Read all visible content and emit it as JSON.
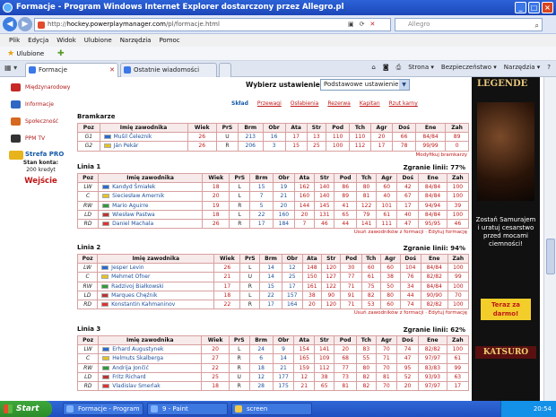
{
  "window": {
    "title": "Formacje - Program Windows Internet Explorer dostarczony przez Allegro.pl"
  },
  "address": {
    "prefix": "http://",
    "domain": "hockey.powerplaymanager.com",
    "path": "/pl/formacje.html",
    "search_placeholder": "Allegro"
  },
  "menu": [
    "Plik",
    "Edycja",
    "Widok",
    "Ulubione",
    "Narzędzia",
    "Pomoc"
  ],
  "favorites": {
    "label": "Ulubione"
  },
  "tabs": [
    {
      "label": "Formacje",
      "active": true
    },
    {
      "label": "Ostatnie wiadomości",
      "active": false
    }
  ],
  "commands": [
    "Strona ▾",
    "Bezpieczeństwo ▾",
    "Narzędzia ▾"
  ],
  "sidebar": {
    "items": [
      {
        "label": "Międzynarodowy",
        "color": "#c62828"
      },
      {
        "label": "Informacje",
        "color": "#2f67c4"
      },
      {
        "label": "Społeczność",
        "color": "#d6681f"
      },
      {
        "label": "PPM TV",
        "color": "#333333"
      }
    ],
    "strefa": "Strefa PRO",
    "stan_label": "Stan konta:",
    "stan_value": "200 kredyt",
    "logout": "Wejście"
  },
  "settings": {
    "label": "Wybierz ustawienie:",
    "value": "Podstawowe ustawienie"
  },
  "links": [
    "Skład",
    "Przewagi",
    "Osłabienia",
    "Rezerwa",
    "Kapitan",
    "Rzut karny"
  ],
  "columns": [
    "Poz",
    "Imię zawodnika",
    "Wiek",
    "PrS",
    "Brm",
    "Obr",
    "Ata",
    "Str",
    "Pod",
    "Tch",
    "Agr",
    "Doś",
    "Ene",
    "Zah"
  ],
  "goalies": {
    "title": "Bramkarze",
    "rows": [
      [
        "G1",
        "Mušil Čeleznik",
        "26",
        "U",
        "213",
        "16",
        "17",
        "13",
        "110",
        "110",
        "20",
        "66",
        "84/84",
        "89"
      ],
      [
        "G2",
        "Ján Pekár",
        "26",
        "R",
        "206",
        "3",
        "15",
        "25",
        "100",
        "112",
        "17",
        "78",
        "99/99",
        "0"
      ]
    ],
    "note": "Modyfikuj bramkarzy"
  },
  "lines": [
    {
      "title": "Linia 1",
      "zgranie": "Zgranie linii: 77%",
      "rows": [
        [
          "LW",
          "Kandyd Śmiałek",
          "18",
          "L",
          "15",
          "19",
          "162",
          "140",
          "86",
          "80",
          "60",
          "42",
          "84/84",
          "100"
        ],
        [
          "C",
          "Sieciesław Amernik",
          "20",
          "L",
          "7",
          "21",
          "160",
          "140",
          "89",
          "81",
          "40",
          "67",
          "84/84",
          "100"
        ],
        [
          "RW",
          "Mario Aguirre",
          "19",
          "R",
          "5",
          "20",
          "144",
          "145",
          "41",
          "122",
          "101",
          "17",
          "94/94",
          "39"
        ],
        [
          "LD",
          "Wiesław Pastwa",
          "18",
          "L",
          "22",
          "160",
          "20",
          "131",
          "65",
          "79",
          "61",
          "40",
          "84/84",
          "100"
        ],
        [
          "RD",
          "Daniel Machala",
          "26",
          "R",
          "17",
          "184",
          "7",
          "46",
          "44",
          "141",
          "111",
          "47",
          "95/95",
          "46"
        ]
      ],
      "note": "Usuń zawodników z formacji · Edytuj formację"
    },
    {
      "title": "Linia 2",
      "zgranie": "Zgranie linii: 94%",
      "rows": [
        [
          "LW",
          "Jesper Levin",
          "26",
          "L",
          "14",
          "12",
          "148",
          "120",
          "30",
          "60",
          "60",
          "104",
          "84/84",
          "100"
        ],
        [
          "C",
          "Mehmet Ofner",
          "21",
          "U",
          "14",
          "25",
          "150",
          "127",
          "77",
          "61",
          "38",
          "76",
          "82/82",
          "99"
        ],
        [
          "RW",
          "Radzivoj Białkowski",
          "17",
          "R",
          "15",
          "17",
          "161",
          "122",
          "71",
          "75",
          "50",
          "34",
          "84/84",
          "100"
        ],
        [
          "LD",
          "Marques Chęźnik",
          "18",
          "L",
          "22",
          "157",
          "38",
          "90",
          "91",
          "82",
          "80",
          "44",
          "90/90",
          "70"
        ],
        [
          "RD",
          "Konstantin Kahmaninov",
          "22",
          "R",
          "17",
          "164",
          "20",
          "120",
          "71",
          "53",
          "60",
          "74",
          "82/82",
          "100"
        ]
      ],
      "note": "Usuń zawodników z formacji · Edytuj formację"
    },
    {
      "title": "Linia 3",
      "zgranie": "Zgranie linii: 62%",
      "rows": [
        [
          "LW",
          "Erhard Augustynek",
          "20",
          "L",
          "24",
          "9",
          "154",
          "141",
          "20",
          "83",
          "70",
          "74",
          "82/82",
          "100"
        ],
        [
          "C",
          "Helmuts Skalberga",
          "27",
          "R",
          "6",
          "14",
          "165",
          "109",
          "68",
          "55",
          "71",
          "47",
          "97/97",
          "61"
        ],
        [
          "RW",
          "Andrija Jončić",
          "22",
          "R",
          "18",
          "21",
          "159",
          "112",
          "77",
          "80",
          "70",
          "95",
          "83/83",
          "99"
        ],
        [
          "LD",
          "Fritz Richard",
          "25",
          "U",
          "12",
          "177",
          "12",
          "38",
          "73",
          "82",
          "81",
          "52",
          "93/93",
          "63"
        ],
        [
          "RD",
          "Vladislav Smerlak",
          "18",
          "R",
          "28",
          "175",
          "21",
          "65",
          "81",
          "82",
          "70",
          "20",
          "97/97",
          "17"
        ]
      ],
      "note": "Usuń zawodników z formacji · Edytuj formację"
    }
  ],
  "ad": {
    "logo": "LEGENDE",
    "text": "Zostań Samurajem i uratuj cesarstwo przed mocami ciemności!",
    "cta": "Teraz za darmo!",
    "brand": "KATSURO"
  },
  "taskbar": {
    "start": "Start",
    "tasks": [
      "Formacje - Program ...",
      "9 - Paint",
      "screen"
    ],
    "clock": "20:54"
  }
}
